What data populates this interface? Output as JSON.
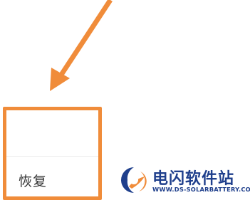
{
  "menu": {
    "items": [
      {
        "label": "恢复"
      }
    ]
  },
  "annotation": {
    "arrow_color": "#f08c3a",
    "highlight_color": "#f08c3a"
  },
  "watermark": {
    "title": "电闪软件站",
    "url": "WWW.DS-SOLARBATTERY.COM",
    "logo_icon": "lightning-logo-icon",
    "brand_blue": "#1f3f8c",
    "brand_orange": "#f08c3a"
  }
}
